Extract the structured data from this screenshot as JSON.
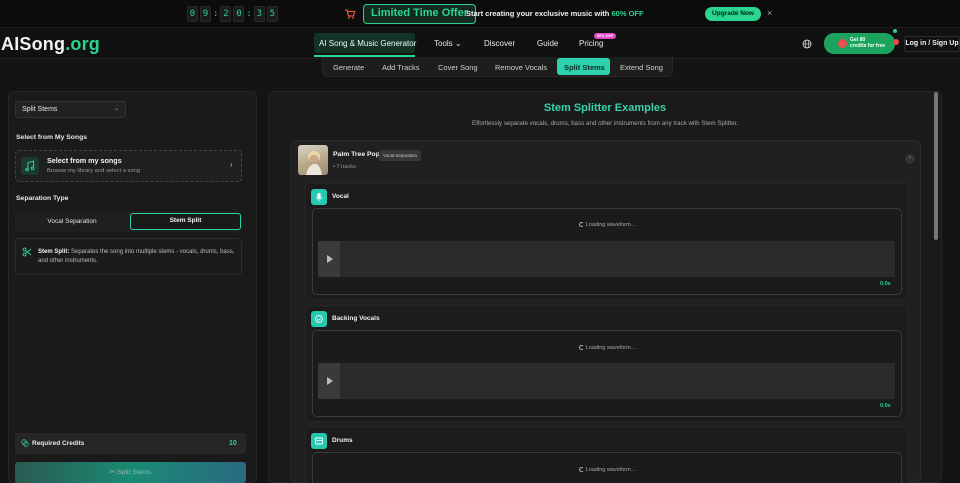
{
  "promo": {
    "timer": [
      "0",
      "9",
      "2",
      "0",
      "3",
      "5"
    ],
    "offer_label": "Limited Time Offer",
    "text": "Start creating your exclusive music with",
    "discount": "60% OFF",
    "cta": "Upgrade Now",
    "close": "×"
  },
  "header": {
    "logo_main": "AISong",
    "logo_suffix": ".org",
    "nav": [
      {
        "label": "AI Song & Music Generator"
      },
      {
        "label": "Tools ⌄"
      },
      {
        "label": "Discover"
      },
      {
        "label": "Guide"
      },
      {
        "label": "Pricing"
      }
    ],
    "new_badge": "60% OFF",
    "credits": "Get 80",
    "credits_line2": "credits for free",
    "login": "Log in / Sign Up"
  },
  "subnav": {
    "items": [
      "Generate",
      "Add Tracks",
      "Cover Song",
      "Remove Vocals",
      "Split Stems",
      "Extend Song"
    ],
    "active": "Split Stems"
  },
  "left": {
    "mode_select": "Split Stems",
    "select_label": "Select from My Songs",
    "my_songs_title": "Select from my songs",
    "my_songs_sub": "Browse my library and select a song",
    "separation_label": "Separation Type",
    "options": [
      "Vocal Separation",
      "Stem Split"
    ],
    "info_bold": "Stem Split:",
    "info_text": " Separates the song into multiple stems - vocals, drums, bass, and other instruments.",
    "required_credits_label": "Required Credits",
    "required_credits_value": "10",
    "split_button": "Split Stems"
  },
  "right": {
    "title": "Stem Splitter Examples",
    "subtitle": "Effortlessly separate vocals, drums, bass and other instruments from any track with Stem Splitter.",
    "song": {
      "name": "Palm Tree Pop",
      "tag": "Vocal Separation",
      "tracks": "• 7 tracks"
    },
    "stems": [
      {
        "name": "Vocal",
        "loading": "Loading waveform...",
        "duration": "0.0s"
      },
      {
        "name": "Backing Vocals",
        "loading": "Loading waveform...",
        "duration": "0.0s"
      },
      {
        "name": "Drums",
        "loading": "Loading waveform..."
      }
    ]
  },
  "colors": {
    "accent": "#2bd48f",
    "teal": "#2fd2ae",
    "bg": "#141414"
  }
}
